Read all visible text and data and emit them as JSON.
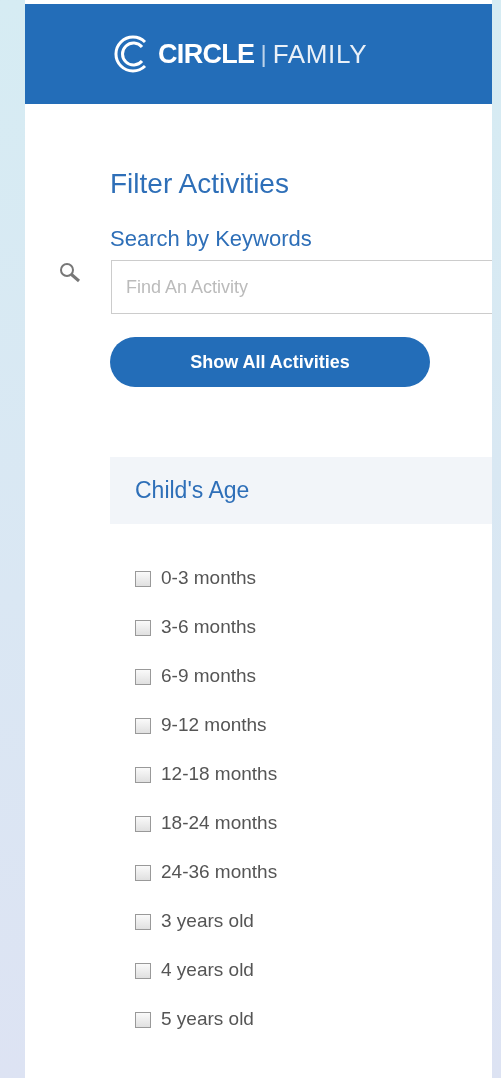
{
  "header": {
    "brand": "CIRCLE",
    "separator": "|",
    "product": "FAMILY"
  },
  "filter": {
    "title": "Filter Activities",
    "search_label": "Search by Keywords",
    "search": {
      "placeholder": "Find An Activity"
    },
    "button": "Show All Activities"
  },
  "age_section": {
    "title": "Child's Age",
    "options": [
      {
        "label": "0-3 months",
        "checked": false
      },
      {
        "label": "3-6 months",
        "checked": false
      },
      {
        "label": "6-9 months",
        "checked": false
      },
      {
        "label": "9-12 months",
        "checked": false
      },
      {
        "label": "12-18 months",
        "checked": false
      },
      {
        "label": "18-24 months",
        "checked": false
      },
      {
        "label": "24-36 months",
        "checked": false
      },
      {
        "label": "3 years old",
        "checked": false
      },
      {
        "label": "4 years old",
        "checked": false
      },
      {
        "label": "5 years old",
        "checked": false
      }
    ]
  }
}
